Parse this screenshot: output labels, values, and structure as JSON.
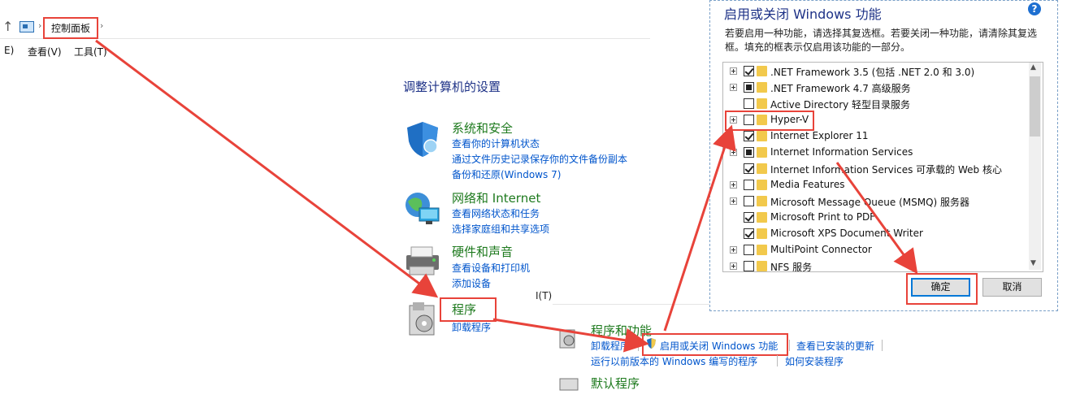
{
  "address_bar": {
    "breadcrumb": "控制面板",
    "up_arrow": "↑",
    "chevron": "›"
  },
  "menu": {
    "items": [
      "E)",
      "查看(V)",
      "工具(T)"
    ]
  },
  "main": {
    "heading": "调整计算机的设置",
    "categories": [
      {
        "title": "系统和安全",
        "links": [
          "查看你的计算机状态",
          "通过文件历史记录保存你的文件备份副本",
          "备份和还原(Windows 7)"
        ]
      },
      {
        "title": "网络和 Internet",
        "links": [
          "查看网络状态和任务",
          "选择家庭组和共享选项"
        ]
      },
      {
        "title": "硬件和声音",
        "links": [
          "查看设备和打印机",
          "添加设备"
        ]
      },
      {
        "title": "程序",
        "links": [
          "卸载程序"
        ]
      }
    ]
  },
  "programs_panel": {
    "fragment": "I(T)",
    "title": "程序和功能",
    "links": [
      "卸载程序",
      "启用或关闭 Windows 功能",
      "查看已安装的更新",
      "运行以前版本的 Windows 编写的程序",
      "如何安装程序"
    ],
    "next_title": "默认程序"
  },
  "dialog": {
    "title": "启用或关闭 Windows 功能",
    "help": "?",
    "description": "若要启用一种功能，请选择其复选框。若要关闭一种功能，请清除其复选框。填充的框表示仅启用该功能的一部分。",
    "features": [
      {
        "label": ".NET Framework 3.5 (包括 .NET 2.0 和 3.0)",
        "expandable": true,
        "state": "checked"
      },
      {
        "label": ".NET Framework 4.7 高级服务",
        "expandable": true,
        "state": "partial"
      },
      {
        "label": "Active Directory 轻型目录服务",
        "expandable": false,
        "state": "unchecked"
      },
      {
        "label": "Hyper-V",
        "expandable": true,
        "state": "unchecked"
      },
      {
        "label": "Internet Explorer 11",
        "expandable": false,
        "state": "checked"
      },
      {
        "label": "Internet Information Services",
        "expandable": true,
        "state": "partial"
      },
      {
        "label": "Internet Information Services 可承载的 Web 核心",
        "expandable": false,
        "state": "checked"
      },
      {
        "label": "Media Features",
        "expandable": true,
        "state": "unchecked"
      },
      {
        "label": "Microsoft Message Queue (MSMQ) 服务器",
        "expandable": true,
        "state": "unchecked"
      },
      {
        "label": "Microsoft Print to PDF",
        "expandable": false,
        "state": "checked"
      },
      {
        "label": "Microsoft XPS Document Writer",
        "expandable": false,
        "state": "checked"
      },
      {
        "label": "MultiPoint Connector",
        "expandable": true,
        "state": "unchecked"
      },
      {
        "label": "NFS 服务",
        "expandable": true,
        "state": "unchecked"
      }
    ],
    "ok_label": "确定",
    "cancel_label": "取消"
  },
  "colors": {
    "accent_red": "#e8433a",
    "link_blue": "#0055cc",
    "category_green": "#1e7a1e"
  }
}
